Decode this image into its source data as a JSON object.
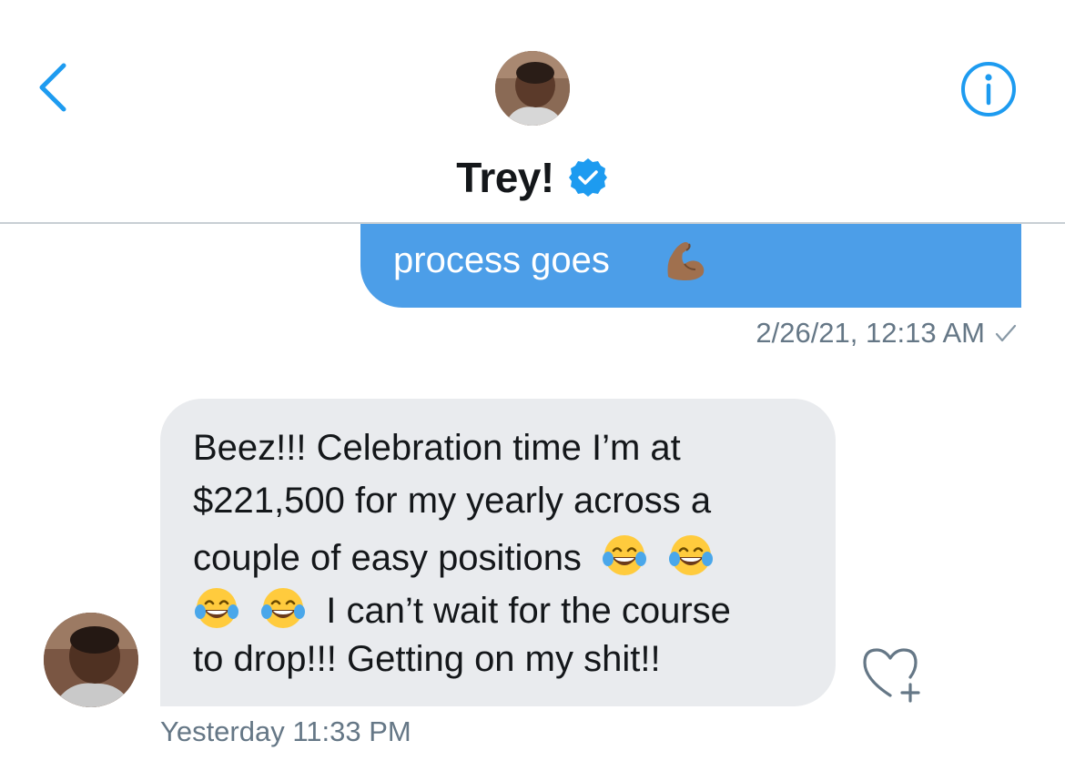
{
  "header": {
    "contact_name": "Trey!",
    "verified": true
  },
  "messages": {
    "outgoing": {
      "text": "process goes",
      "emoji": "flexed-biceps",
      "timestamp": "2/26/21, 12:13 AM"
    },
    "incoming": {
      "lines": [
        "Beez!!! Celebration time I’m at",
        "$221,500 for my yearly across a",
        "couple of easy positions",
        "I can’t wait for the course",
        "to drop!!! Getting on my shit!!"
      ],
      "emoji": "face-with-tears-of-joy",
      "timestamp": "Yesterday 11:33 PM"
    }
  },
  "colors": {
    "accent": "#1d9bf0",
    "outgoing_bubble": "#4c9ee8",
    "incoming_bubble": "#e9ebee",
    "meta_text": "#657786"
  }
}
